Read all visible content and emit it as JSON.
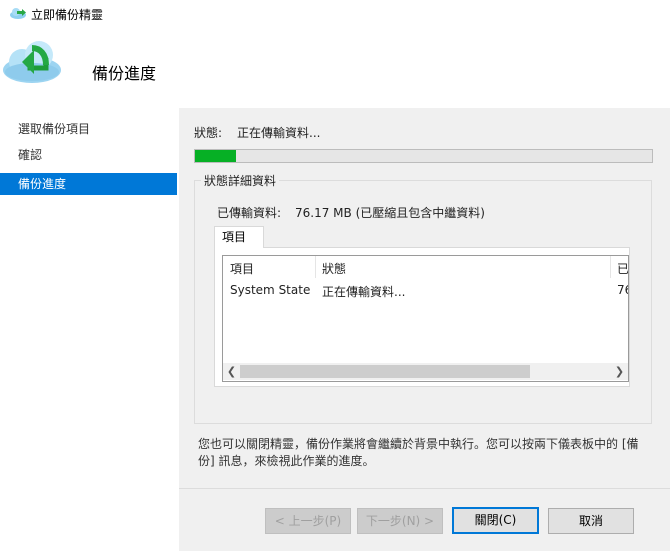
{
  "window": {
    "title": "立即備份精靈"
  },
  "header": {
    "title": "備份進度"
  },
  "sidebar": {
    "items": [
      {
        "label": "選取備份項目"
      },
      {
        "label": "確認"
      },
      {
        "label": "備份進度"
      }
    ]
  },
  "status": {
    "label": "狀態:",
    "value": "正在傳輸資料...",
    "progress_fraction": 0.09
  },
  "details": {
    "legend": "狀態詳細資料",
    "transfer_label": "已傳輸資料:",
    "transfer_value": "76.17 MB (已壓縮且包含中繼資料)",
    "tab_label": "項目",
    "columns": [
      "項目",
      "狀態",
      "已"
    ],
    "rows": [
      {
        "item": "System State",
        "status": "正在傳輸資料...",
        "extra": "76"
      }
    ]
  },
  "info_text": "您也可以關閉精靈，備份作業將會繼續於背景中執行。您可以按兩下儀表板中的 [備份] 訊息，來檢視此作業的進度。",
  "buttons": {
    "prev": "< 上一步(P)",
    "next": "下一步(N) >",
    "close": "關閉(C)",
    "cancel": "取消"
  },
  "colors": {
    "accent": "#0078d7",
    "progress": "#06b025"
  },
  "icons": {
    "title": "backup-cloud-icon",
    "header": "backup-cloud-arrow-icon"
  }
}
